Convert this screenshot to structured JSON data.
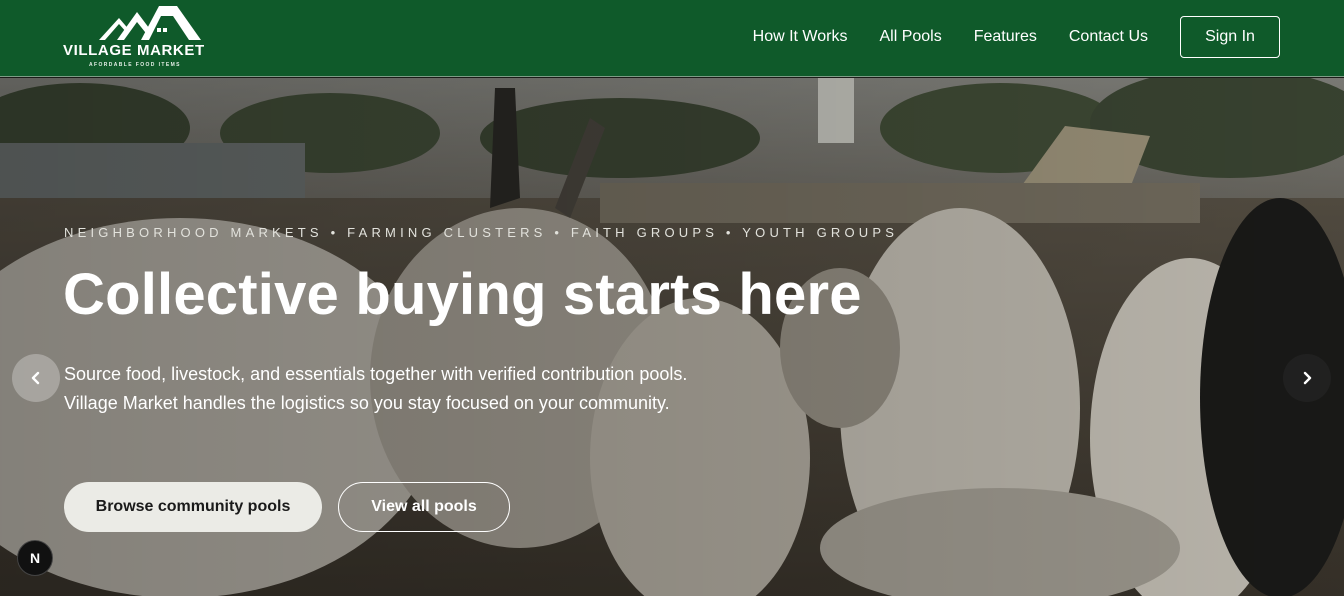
{
  "brand": {
    "name": "VILLAGE MARKET",
    "tagline": "AFORDABLE FOOD ITEMS"
  },
  "nav": {
    "links": [
      "How It Works",
      "All Pools",
      "Features",
      "Contact Us"
    ],
    "signin_label": "Sign In"
  },
  "hero": {
    "eyebrow": "NEIGHBORHOOD MARKETS • FARMING CLUSTERS • FAITH GROUPS • YOUTH GROUPS",
    "headline": "Collective buying starts here",
    "subtext": "Source food, livestock, and essentials together with verified contribution pools. Village Market handles the logistics so you stay focused on your community.",
    "primary_cta": "Browse community pools",
    "secondary_cta": "View all pools",
    "prev_icon": "chevron-left-icon",
    "next_icon": "chevron-right-icon"
  },
  "dev_badge": "N",
  "colors": {
    "header_bg": "#0f5a2a",
    "primary_button_bg": "#ebebe6"
  }
}
